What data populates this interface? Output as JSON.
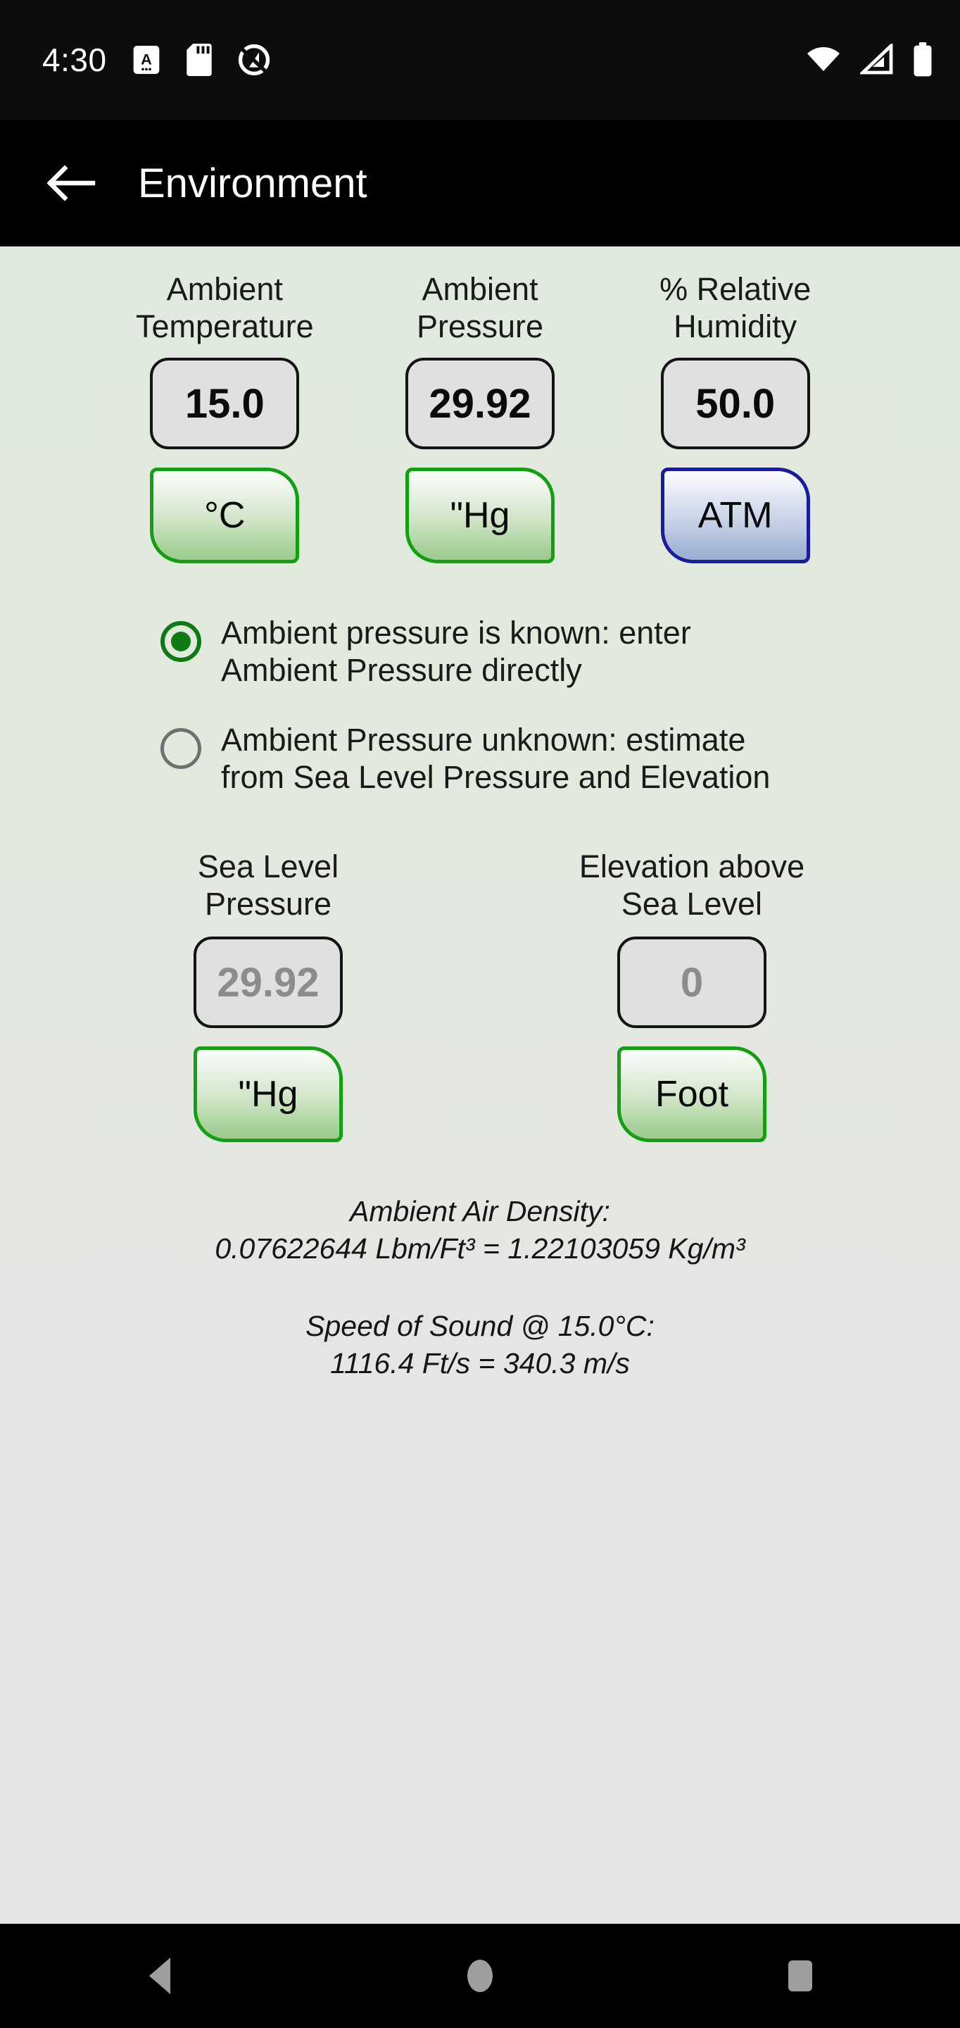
{
  "status_bar": {
    "clock": "4:30",
    "left_icons": [
      "accessibility-a-icon",
      "sd-card-icon",
      "circle-logo-icon"
    ],
    "right_icons": [
      "wifi-icon",
      "cell-signal-icon",
      "battery-icon"
    ]
  },
  "app_bar": {
    "back_icon": "arrow-left-icon",
    "title": "Environment"
  },
  "ambient": {
    "fields": [
      {
        "label": "Ambient\nTemperature",
        "value": "15.0",
        "unit": "°C",
        "unit_style": "green",
        "dim": false
      },
      {
        "label": "Ambient\nPressure",
        "value": "29.92",
        "unit": "\"Hg",
        "unit_style": "green",
        "dim": false
      },
      {
        "label": "% Relative\nHumidity",
        "value": "50.0",
        "unit": "ATM",
        "unit_style": "blue",
        "dim": false
      }
    ]
  },
  "pressure_mode": {
    "options": [
      {
        "label": "Ambient pressure is known: enter\nAmbient Pressure directly",
        "selected": true
      },
      {
        "label": "Ambient Pressure unknown: estimate\nfrom Sea Level Pressure and Elevation",
        "selected": false
      }
    ]
  },
  "sea_level": {
    "fields": [
      {
        "label": "Sea Level\nPressure",
        "value": "29.92",
        "unit": "\"Hg",
        "unit_style": "green",
        "dim": true
      },
      {
        "label": "Elevation above\nSea Level",
        "value": "0",
        "unit": "Foot",
        "unit_style": "green",
        "dim": true
      }
    ]
  },
  "results": [
    {
      "title": "Ambient Air Density:",
      "detail": "0.07622644 Lbm/Ft³ = 1.22103059 Kg/m³"
    },
    {
      "title": "Speed of Sound @ 15.0°C:",
      "detail": "1116.4 Ft/s = 340.3 m/s"
    }
  ],
  "nav_bar": {
    "back_icon": "triangle-back-icon",
    "home_icon": "circle-home-icon",
    "recents_icon": "square-recents-icon"
  },
  "colors": {
    "green_accent": "#12a012",
    "blue_accent": "#1b1b9e",
    "radio_on": "#0d7a14",
    "background_top": "#e1eade",
    "background_bottom": "#e5e5e5"
  }
}
